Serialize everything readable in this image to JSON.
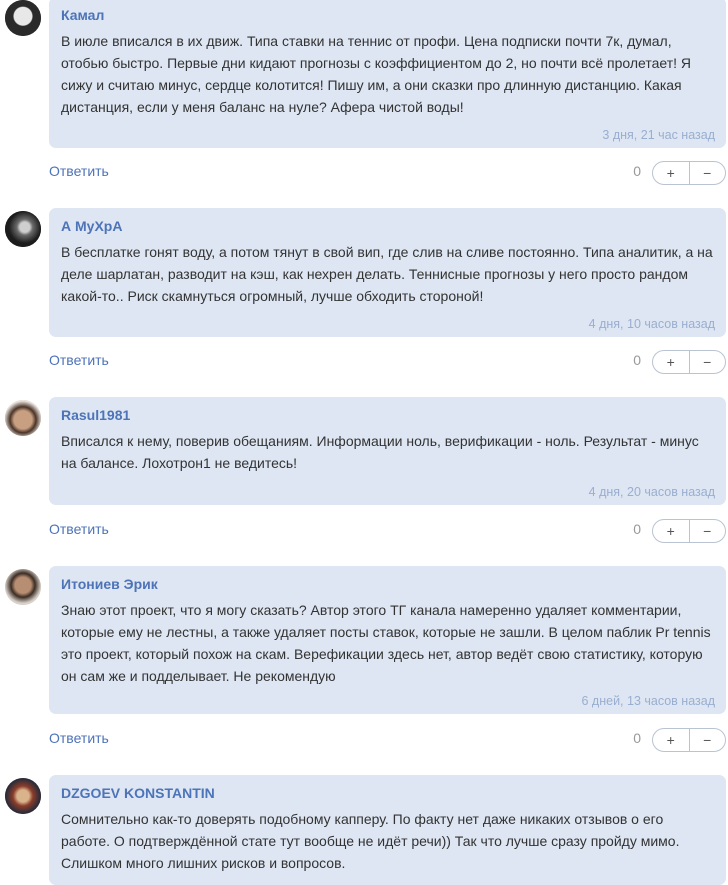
{
  "reply_label": "Ответить",
  "plus_label": "+",
  "minus_label": "−",
  "comments": [
    {
      "author": "Камал",
      "text": "В июле вписался в их движ. Типа ставки на теннис от профи. Цена подписки почти 7к, думал, отобью быстро. Первые дни кидают прогнозы с коэффициентом до 2, но почти всё пролетает! Я сижу и считаю минус, сердце колотится! Пишу им, а они сказки про длинную дистанцию. Какая дистанция, если у меня баланс на нуле? Афера чистой воды!",
      "time": "3 дня, 21 час назад",
      "votes": "0"
    },
    {
      "author": "А МуХрА",
      "text": "В бесплатке гонят воду, а потом тянут в свой вип, где слив на сливе постоянно. Типа аналитик, а на деле шарлатан, разводит на кэш, как нехрен делать. Теннисные прогнозы у него просто рандом какой-то.. Риск скамнуться огромный, лучше обходить стороной!",
      "time": "4 дня, 10 часов назад",
      "votes": "0"
    },
    {
      "author": "Rasul1981",
      "text": "Вписался к нему, поверив обещаниям. Информации ноль, верификации - ноль. Результат - минус на балансе. Лохотрон1 не ведитесь!",
      "time": "4 дня, 20 часов назад",
      "votes": "0"
    },
    {
      "author": "Итониев Эрик",
      "text": "Знаю этот проект, что я могу сказать? Автор этого ТГ канала намеренно удаляет комментарии, которые ему не лестны, а также удаляет посты ставок, которые не зашли. В целом паблик Pr tennis это проект, который похож на скам. Верефикации здесь нет, автор ведёт свою статистику, которую он сам же и подделывает. Не рекомендую",
      "time": "6 дней, 13 часов назад",
      "votes": "0"
    },
    {
      "author": "DZGOEV KONSTANTIN",
      "text": "Сомнительно как-то доверять подобному капперу. По факту нет даже никаких отзывов о его работе. О подтверждённой стате тут вообще не идёт речи)) Так что лучше сразу пройду мимо. Слишком много лишних рисков и вопросов.",
      "time": "",
      "votes": ""
    }
  ]
}
